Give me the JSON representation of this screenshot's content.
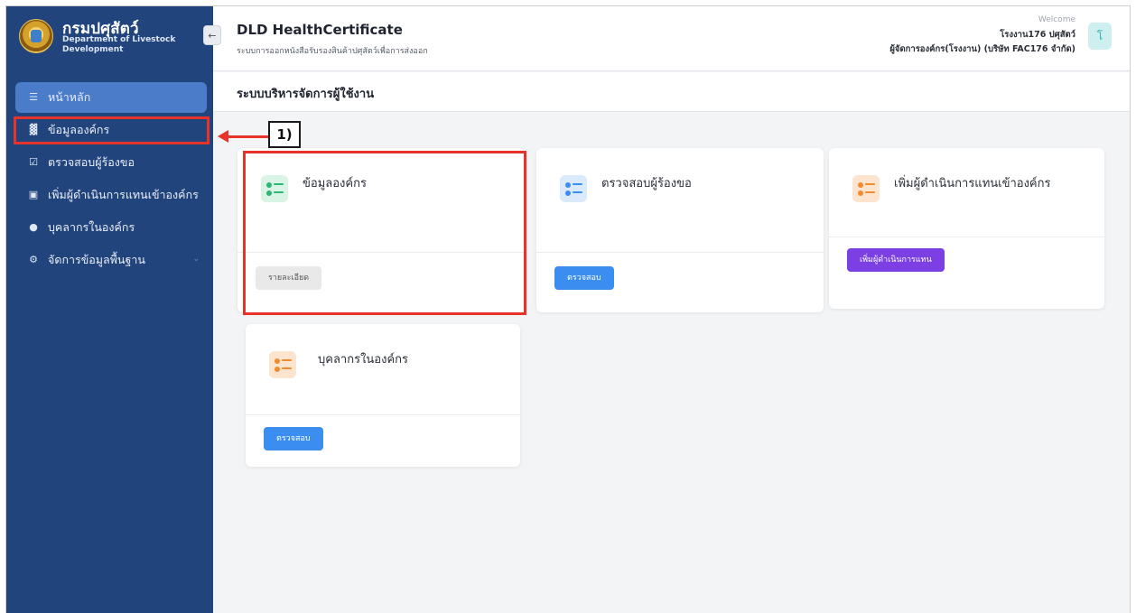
{
  "brand": {
    "name_th": "กรมปศุสัตว์",
    "name_en": "Department of Livestock Development",
    "collapse_icon": "arrow-left-icon"
  },
  "header": {
    "app_title": "DLD HealthCertificate",
    "app_subtitle": "ระบบการออกหนังสือรับรองสินค้าปศุสัตว์เพื่อการส่งออก",
    "welcome": "Welcome",
    "user_name": "โรงงาน176 ปศุสัตว์",
    "user_role": "ผู้จัดการองค์กร(โรงงาน) (บริษัท FAC176 จำกัด)",
    "avatar_letter": "โ"
  },
  "page_title": "ระบบบริหารจัดการผู้ใช้งาน",
  "sidebar": {
    "items": [
      {
        "label": "หน้าหลัก",
        "icon": "layers-icon",
        "active": true
      },
      {
        "label": "ข้อมูลองค์กร",
        "icon": "bank-icon"
      },
      {
        "label": "ตรวจสอบผู้ร้องขอ",
        "icon": "check-square-icon"
      },
      {
        "label": "เพิ่มผู้ดำเนินการแทนเข้าองค์กร",
        "icon": "user-card-icon"
      },
      {
        "label": "บุคลากรในองค์กร",
        "icon": "users-icon"
      },
      {
        "label": "จัดการข้อมูลพื้นฐาน",
        "icon": "gear-icon"
      }
    ]
  },
  "callout_label": "1)",
  "cards": [
    {
      "title": "ข้อมูลองค์กร",
      "button": "รายละเอียด",
      "color": "#2bb673"
    },
    {
      "title": "ตรวจสอบผู้ร้องขอ",
      "button": "ตรวจสอบ",
      "color": "#3b8ef0"
    },
    {
      "title": "เพิ่มผู้ดำเนินการแทนเข้าองค์กร",
      "button": "เพิ่มผู้ดำเนินการแทน",
      "color": "#f28a30"
    },
    {
      "title": "บุคลากรในองค์กร",
      "button": "ตรวจสอบ",
      "color": "#f28a30"
    }
  ],
  "colors": {
    "sidebar_bg": "#22447d",
    "active_item": "#4a7cc9",
    "highlight": "#e8332a",
    "btn_blue": "#3b8ef0",
    "btn_purple": "#7b3fe4",
    "btn_gray": "#e9e9ea"
  }
}
